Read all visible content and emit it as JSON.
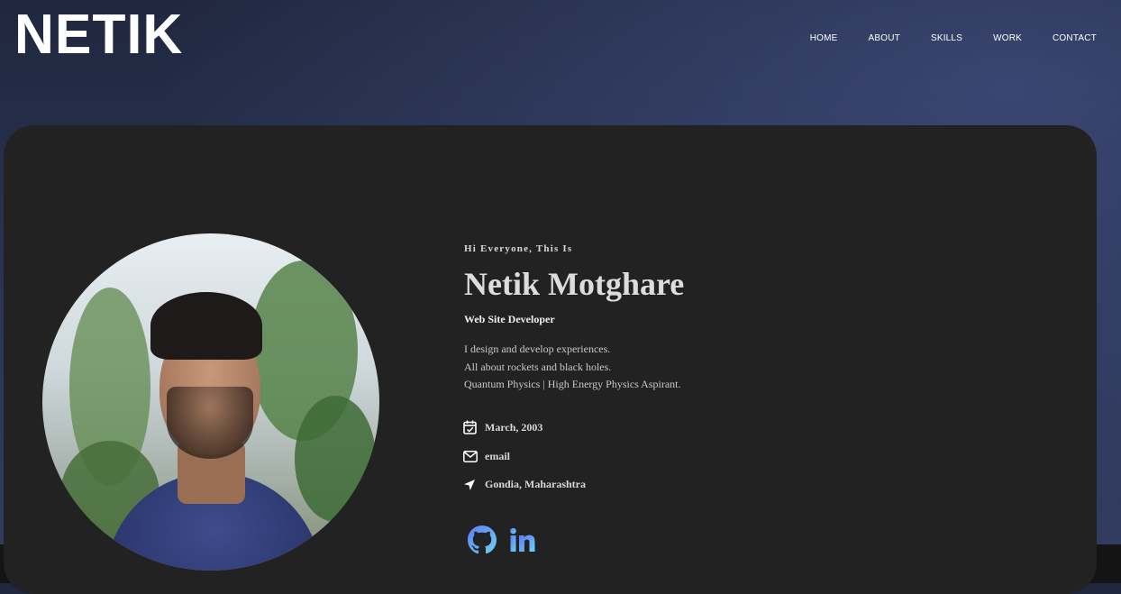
{
  "logo": "NETIK",
  "nav": [
    "HOME",
    "ABOUT",
    "SKILLS",
    "WORK",
    "CONTACT"
  ],
  "hero": {
    "greeting": "Hi Everyone, This Is",
    "name": "Netik Motghare",
    "role": "Web Site Developer",
    "bio": [
      "I design and develop experiences.",
      "All about rockets and black holes.",
      "Quantum Physics | High Energy Physics Aspirant."
    ]
  },
  "info": {
    "birth": "March, 2003",
    "email": "email",
    "location": "Gondia, Maharashtra"
  },
  "icons": {
    "birth": "calendar-check-icon",
    "email": "envelope-icon",
    "location": "location-arrow-icon",
    "github": "github-icon",
    "linkedin": "linkedin-icon"
  },
  "colors": {
    "social_gradient_start": "#5b7cf5",
    "social_gradient_end": "#6fd1f2",
    "card_bg": "#222222"
  }
}
